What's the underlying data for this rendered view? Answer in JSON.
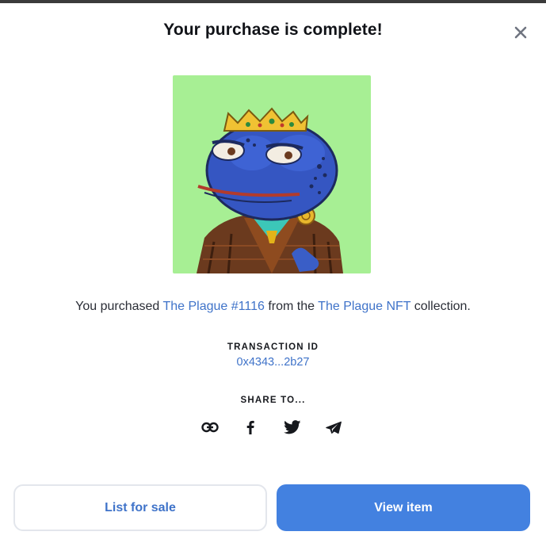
{
  "modal": {
    "title": "Your purchase is complete!",
    "close_icon": "close-icon"
  },
  "nft": {
    "image": "nft-image",
    "background_color": "#a7ef94"
  },
  "purchase": {
    "prefix": "You purchased ",
    "item_name": "The Plague #1116",
    "middle": " from the ",
    "collection_name": "The Plague NFT",
    "suffix": " collection."
  },
  "transaction": {
    "label": "TRANSACTION ID",
    "id": "0x4343...2b27"
  },
  "share": {
    "label": "SHARE TO...",
    "icons": [
      "link-icon",
      "facebook-icon",
      "twitter-icon",
      "telegram-icon"
    ]
  },
  "actions": {
    "list_for_sale": "List for sale",
    "view_item": "View item"
  },
  "colors": {
    "accent": "#4381e0",
    "link": "#3f73c9"
  }
}
